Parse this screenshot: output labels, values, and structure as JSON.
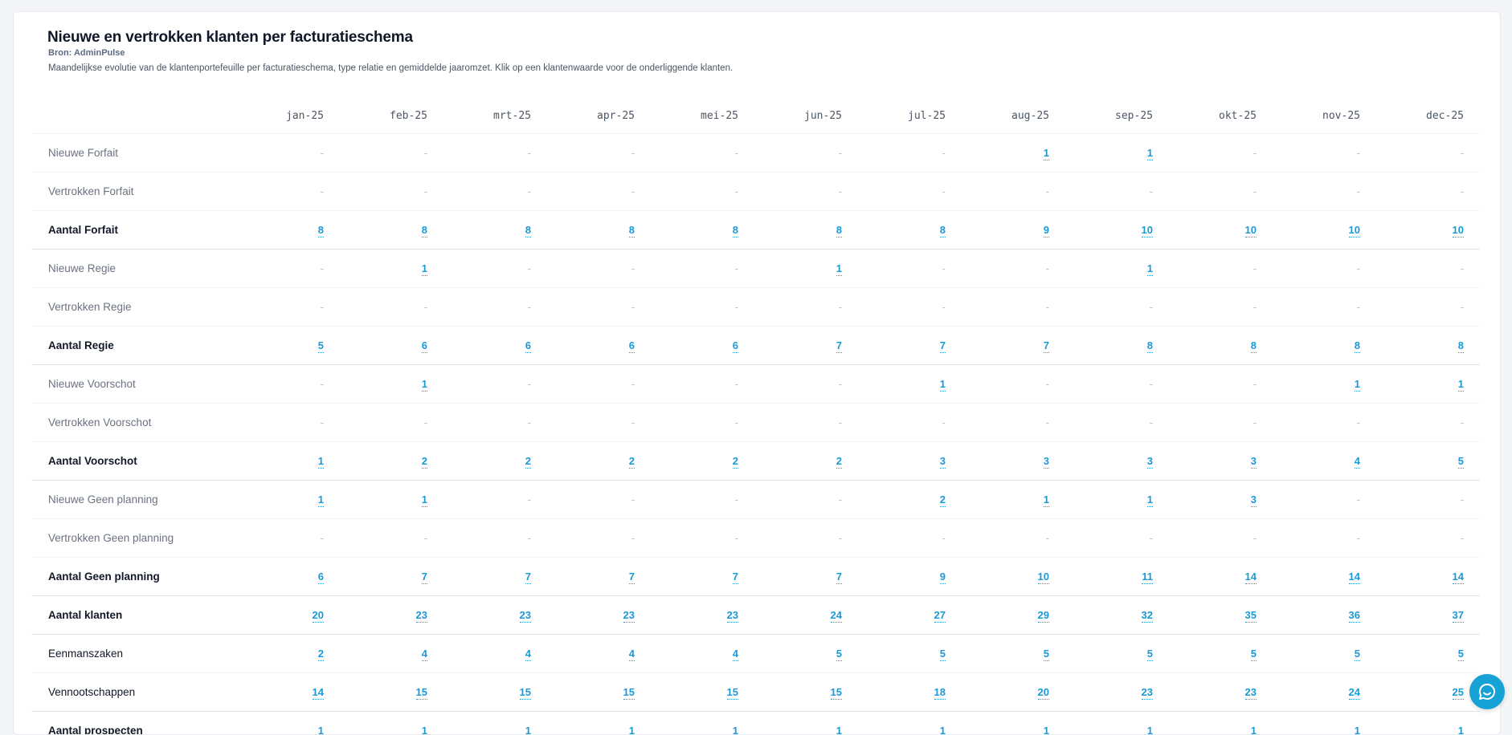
{
  "report": {
    "title": "Nieuwe en vertrokken klanten per facturatieschema",
    "source": "Bron: AdminPulse",
    "description": "Maandelijkse evolutie van de klantenportefeuille per facturatieschema, type relatie en gemiddelde jaaromzet. Klik op een klantenwaarde voor de onderliggende klanten."
  },
  "table": {
    "months": [
      "jan-25",
      "feb-25",
      "mrt-25",
      "apr-25",
      "mei-25",
      "jun-25",
      "jul-25",
      "aug-25",
      "sep-25",
      "okt-25",
      "nov-25",
      "dec-25"
    ],
    "rows": [
      {
        "label": "Nieuwe Forfait",
        "style": "light",
        "values": [
          "-",
          "-",
          "-",
          "-",
          "-",
          "-",
          "-",
          "1",
          "1",
          "-",
          "-",
          "-"
        ]
      },
      {
        "label": "Vertrokken Forfait",
        "style": "light",
        "values": [
          "-",
          "-",
          "-",
          "-",
          "-",
          "-",
          "-",
          "-",
          "-",
          "-",
          "-",
          "-"
        ]
      },
      {
        "label": "Aantal Forfait",
        "style": "bold",
        "values": [
          "8",
          "8",
          "8",
          "8",
          "8",
          "8",
          "8",
          "9",
          "10",
          "10",
          "10",
          "10"
        ]
      },
      {
        "label": "Nieuwe Regie",
        "style": "light",
        "values": [
          "-",
          "1",
          "-",
          "-",
          "-",
          "1",
          "-",
          "-",
          "1",
          "-",
          "-",
          "-"
        ]
      },
      {
        "label": "Vertrokken Regie",
        "style": "light",
        "values": [
          "-",
          "-",
          "-",
          "-",
          "-",
          "-",
          "-",
          "-",
          "-",
          "-",
          "-",
          "-"
        ]
      },
      {
        "label": "Aantal Regie",
        "style": "bold",
        "values": [
          "5",
          "6",
          "6",
          "6",
          "6",
          "7",
          "7",
          "7",
          "8",
          "8",
          "8",
          "8"
        ]
      },
      {
        "label": "Nieuwe Voorschot",
        "style": "light",
        "values": [
          "-",
          "1",
          "-",
          "-",
          "-",
          "-",
          "1",
          "-",
          "-",
          "-",
          "1",
          "1"
        ]
      },
      {
        "label": "Vertrokken Voorschot",
        "style": "light",
        "values": [
          "-",
          "-",
          "-",
          "-",
          "-",
          "-",
          "-",
          "-",
          "-",
          "-",
          "-",
          "-"
        ]
      },
      {
        "label": "Aantal Voorschot",
        "style": "bold",
        "values": [
          "1",
          "2",
          "2",
          "2",
          "2",
          "2",
          "3",
          "3",
          "3",
          "3",
          "4",
          "5"
        ]
      },
      {
        "label": "Nieuwe Geen planning",
        "style": "light",
        "values": [
          "1",
          "1",
          "-",
          "-",
          "-",
          "-",
          "2",
          "1",
          "1",
          "3",
          "-",
          "-"
        ]
      },
      {
        "label": "Vertrokken Geen planning",
        "style": "light",
        "values": [
          "-",
          "-",
          "-",
          "-",
          "-",
          "-",
          "-",
          "-",
          "-",
          "-",
          "-",
          "-"
        ]
      },
      {
        "label": "Aantal Geen planning",
        "style": "bold",
        "values": [
          "6",
          "7",
          "7",
          "7",
          "7",
          "7",
          "9",
          "10",
          "11",
          "14",
          "14",
          "14"
        ]
      },
      {
        "label": "Aantal klanten",
        "style": "bold",
        "values": [
          "20",
          "23",
          "23",
          "23",
          "23",
          "24",
          "27",
          "29",
          "32",
          "35",
          "36",
          "37"
        ]
      },
      {
        "label": "Eenmanszaken",
        "style": "plain",
        "values": [
          "2",
          "4",
          "4",
          "4",
          "4",
          "5",
          "5",
          "5",
          "5",
          "5",
          "5",
          "5"
        ]
      },
      {
        "label": "Vennootschappen",
        "style": "bold-sep",
        "values": [
          "14",
          "15",
          "15",
          "15",
          "15",
          "15",
          "18",
          "20",
          "23",
          "23",
          "24",
          "25"
        ]
      },
      {
        "label": "Aantal prospecten",
        "style": "bold",
        "values": [
          "1",
          "1",
          "1",
          "1",
          "1",
          "1",
          "1",
          "1",
          "1",
          "1",
          "1",
          "1"
        ]
      }
    ]
  },
  "chat": {
    "icon": "chat-bubble-icon"
  },
  "colors": {
    "accent": "#1b9ad6",
    "chat": "#17a2d6"
  }
}
